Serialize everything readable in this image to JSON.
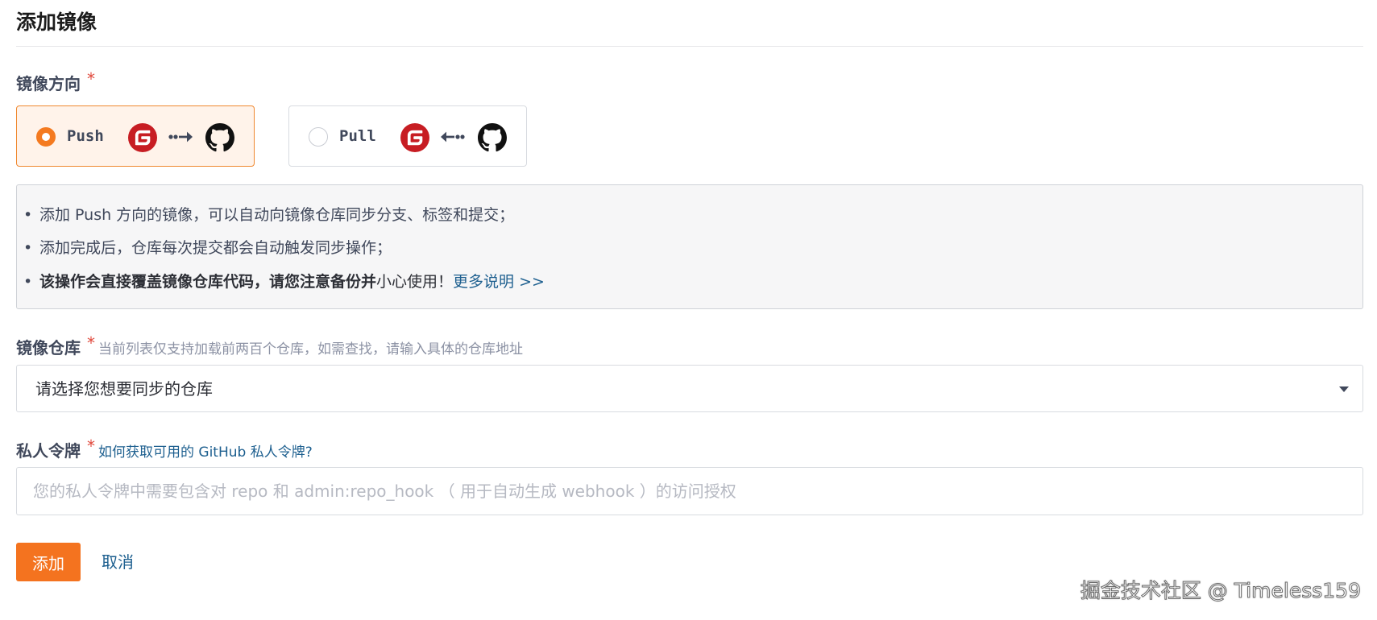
{
  "page": {
    "title": "添加镜像"
  },
  "direction": {
    "label": "镜像方向",
    "required_mark": "*",
    "options": [
      {
        "label": "Push",
        "selected": true
      },
      {
        "label": "Pull",
        "selected": false
      }
    ]
  },
  "info": {
    "items": [
      "添加 Push 方向的镜像，可以自动向镜像仓库同步分支、标签和提交；",
      "添加完成后，仓库每次提交都会自动触发同步操作；"
    ],
    "warning_bold": "该操作会直接覆盖镜像仓库代码，请您注意备份并",
    "warning_plain": "小心使用！",
    "more_link": "更多说明 >>"
  },
  "repo": {
    "label": "镜像仓库",
    "required_mark": "*",
    "hint": "当前列表仅支持加载前两百个仓库，如需查找，请输入具体的仓库地址",
    "placeholder": "请选择您想要同步的仓库"
  },
  "token": {
    "label": "私人令牌",
    "required_mark": "*",
    "help_link": "如何获取可用的 GitHub 私人令牌?",
    "placeholder": "您的私人令牌中需要包含对 repo 和 admin:repo_hook （ 用于自动生成 webhook ）的访问授权"
  },
  "actions": {
    "add_label": "添加",
    "cancel_label": "取消"
  },
  "watermark": "掘金技术社区 @ Timeless159",
  "colors": {
    "accent": "#f4731f",
    "selected_bg": "#fff3ea",
    "link": "#1d5f8f",
    "required": "#e0483b",
    "gitee_red": "#c71d23"
  },
  "icons": {
    "gitee": "gitee-logo-icon",
    "github": "github-logo-icon",
    "push_arrow": "arrow-right-icon",
    "pull_arrow": "arrow-left-icon",
    "dropdown": "caret-down-icon"
  }
}
